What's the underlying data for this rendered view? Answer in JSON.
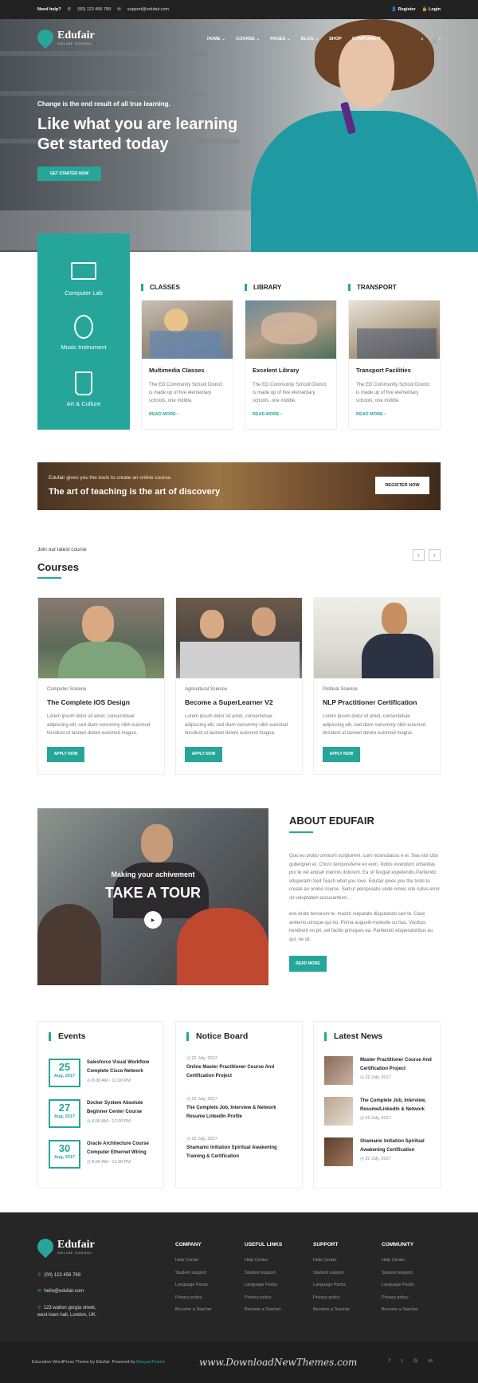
{
  "topbar": {
    "need_help": "Need help?",
    "phone": "(00) 123 456 789",
    "email": "support@edufair.com",
    "register": "Register",
    "login": "Login"
  },
  "brand": {
    "name": "Edufair",
    "tagline": "ONLINE SCHOOL"
  },
  "nav": [
    "HOME",
    "COURSE",
    "PAGES",
    "BLOG",
    "SHOP",
    "COMPONENT"
  ],
  "cart_count": "0",
  "hero": {
    "eyebrow": "Change is the end result of all true learning.",
    "title_line1": "Like what you are learning",
    "title_line2": "Get started today",
    "button": "GET STARTED NOW"
  },
  "features": [
    "Computer Lab",
    "Music Instrument",
    "Art & Culture"
  ],
  "services": [
    {
      "heading": "CLASSES",
      "title": "Multimedia Classes",
      "text": "The ED Community School District is made up of five elementary schools, one middle.",
      "link": "READ MORE"
    },
    {
      "heading": "LIBRARY",
      "title": "Excelent Library",
      "text": "The ED Community School District is made up of five elementary schools, one middle.",
      "link": "READ MORE"
    },
    {
      "heading": "TRANSPORT",
      "title": "Transport Facilities",
      "text": "The ED Community School District is made up of five elementary schools, one middle.",
      "link": "READ MORE"
    }
  ],
  "banner": {
    "small": "Edufair gives you the tools to create an online course.",
    "big": "The art of teaching is the art of discovery",
    "button": "REGISTER NOW"
  },
  "courses_section": {
    "eyebrow": "Join our latest course",
    "title": "Courses"
  },
  "courses": [
    {
      "category": "Computer Science",
      "title": "The Complete iOS Design",
      "text": "Lorem ipsum dolor sit amet, consectetuer adipiscing elit, sed diam nonummy nibh euismod tincidunt ut laoreet dolore euismod magna.",
      "button": "APPLY NOW"
    },
    {
      "category": "Agricultural Science",
      "title": "Become a SuperLearner V2",
      "text": "Lorem ipsum dolor sit amet, consectetuer adipiscing elit, sed diam nonummy nibh euismod tincidunt ut laoreet dolore euismod magna.",
      "button": "APPLY NOW"
    },
    {
      "category": "Political Science",
      "title": "NLP Practitioner Certification",
      "text": "Lorem ipsum dolor sit amet, consectetuer adipiscing elit, sed diam nonummy nibh euismod tincidunt ut laoreet dolore euismod magna.",
      "button": "APPLY NOW"
    }
  ],
  "about": {
    "overlay_small": "Making your achivement",
    "overlay_big": "TAKE A TOUR",
    "title": "ABOUT EDUFAIR",
    "p1": "Quo eu probo omnium scriptorem, cum nostrudassu e ei. Sea nisl cibo gubergren et. Choro temporeferre ex eum. Nobis vivendum urbanitas pro te vel aniparl inermis dolorem. Ea sit feugiat expetendis,Partiendo vituperatm Sed Teach what you love. Edufair gives you the tools to create an online course. Sed ut perspiciatis unde omnis iste natus error sit voluptatem accusantium .",
    "p2": "eos brute bonorum te. mazim vulputate disputando sed te. Case antiemo utroque qui no. Prima augueiti-molestie cu has. Vocibus hendrerit no pri, vel facilis principes ea. Partiendo vituperatoribus eu qui, ne sit.",
    "button": "READ MORE"
  },
  "events": {
    "title": "Events",
    "items": [
      {
        "day": "25",
        "month": "Aug, 2017",
        "title": "Salesforce Visual Workflow Complete Cisco Network",
        "time": "8.00 AM - 12.00 PM"
      },
      {
        "day": "27",
        "month": "Aug, 2017",
        "title": "Docker System Absolute Beginner Center Course",
        "time": "8.00 AM - 12.00 PM"
      },
      {
        "day": "30",
        "month": "Aug, 2017",
        "title": "Oracle Architecture Course Computer Ethernet Wiring",
        "time": "8.00 AM - 12.00 PM"
      }
    ]
  },
  "notice": {
    "title": "Notice Board",
    "items": [
      {
        "date": "22 July, 2017",
        "title": "Online Master Practitioner Course And Certification Project"
      },
      {
        "date": "22 July, 2017",
        "title": "The Complete Job, Interview & Network Resume LinkedIn Profile"
      },
      {
        "date": "22 July, 2017",
        "title": "Shamanic Initiation Spiritual Awakening Training & Certification"
      }
    ]
  },
  "news": {
    "title": "Latest News",
    "items": [
      {
        "title": "Master Practitioner Course And Certification Project",
        "date": "22 July, 2017"
      },
      {
        "title": "The Complete Job, Interview, Resume/LinkedIn & Network",
        "date": "22 July, 2017"
      },
      {
        "title": "Shamanic Initiation Spiritual Awakening Certification",
        "date": "22 July, 2017"
      }
    ]
  },
  "footer": {
    "phone": "(00) 123 456 789",
    "email": "hello@edufair.com",
    "address_line1": "123 walton gorgia street,",
    "address_line2": "west town hall, London, UK.",
    "columns": [
      {
        "title": "COMPANY",
        "links": [
          "Help Center",
          "Student support",
          "Language Packs",
          "Privacy policy",
          "Become a Teacher"
        ]
      },
      {
        "title": "USEFUL LINKS",
        "links": [
          "Help Center",
          "Student support",
          "Language Packs",
          "Privacy policy",
          "Become a Teacher"
        ]
      },
      {
        "title": "SUPPORT",
        "links": [
          "Help Center",
          "Student support",
          "Language Packs",
          "Privacy policy",
          "Become a Teacher"
        ]
      },
      {
        "title": "COMMUNITY",
        "links": [
          "Help Center",
          "Student support",
          "Language Packs",
          "Privacy policy",
          "Become a Teacher"
        ]
      }
    ],
    "copyright": "Education WordPress Theme by Edufair. Powered by",
    "copyright_link": "BanyanTheme",
    "watermark": "www.DownloadNewThemes.com",
    "social": [
      "f",
      "t",
      "G",
      "in"
    ]
  },
  "colors": {
    "accent": "#26a69a",
    "dark": "#262626"
  }
}
